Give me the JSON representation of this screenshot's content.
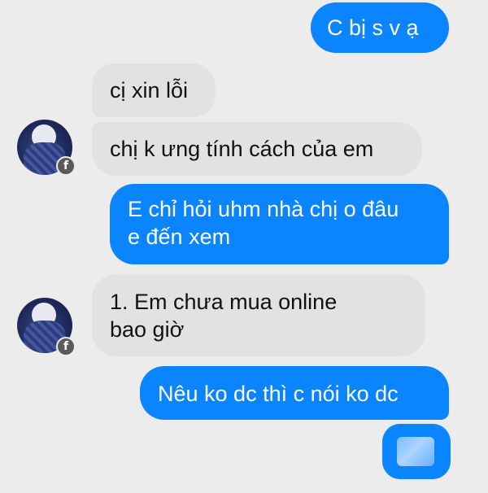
{
  "messages": {
    "m1": {
      "text": "C bị s v ạ"
    },
    "m2": {
      "text": "cị xin lỗi"
    },
    "m3": {
      "text": "chị k ưng tính cách của em"
    },
    "m4": {
      "line1": "E chỉ hỏi uhm nhà chị o đâu",
      "line2": "e đến xem"
    },
    "m5": {
      "line1": "1. Em chưa mua online",
      "line2": "bao giờ"
    },
    "m6": {
      "text": "Nêu ko dc thì c nói ko dc"
    }
  },
  "avatar_badge": "f",
  "colors": {
    "outgoing_bubble": "#0a84ff",
    "incoming_bubble": "#e2e2e2",
    "background": "#ececec"
  }
}
